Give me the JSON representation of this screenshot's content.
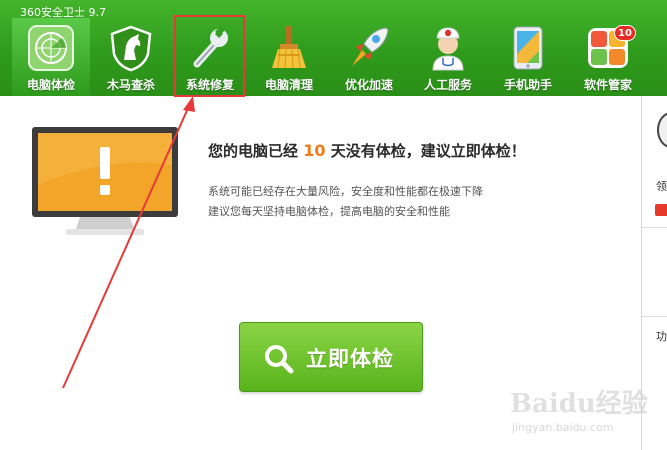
{
  "app": {
    "title": "360安全卫士 9.7"
  },
  "toolbar": {
    "items": [
      {
        "label": "电脑体检",
        "icon": "radar-icon"
      },
      {
        "label": "木马查杀",
        "icon": "horse-shield-icon"
      },
      {
        "label": "系统修复",
        "icon": "wrench-icon"
      },
      {
        "label": "电脑清理",
        "icon": "broom-icon"
      },
      {
        "label": "优化加速",
        "icon": "rocket-icon"
      },
      {
        "label": "人工服务",
        "icon": "doctor-icon"
      },
      {
        "label": "手机助手",
        "icon": "phone-icon"
      },
      {
        "label": "软件管家",
        "icon": "apps-grid-icon"
      }
    ],
    "badge_count": "10"
  },
  "main": {
    "headline_pre": "您的电脑已经",
    "headline_days": "10",
    "headline_post": "天没有体检，建议立即体检！",
    "desc_line1": "系统可能已经存在大量风险，安全度和性能都在极速下降",
    "desc_line2": "建议您每天坚持电脑体检，提高电脑的安全和性能",
    "cta_label": "立即体检"
  },
  "right_panel": {
    "text1": "领",
    "text2": "功"
  },
  "watermark": {
    "brand": "Baidu经验",
    "sub": "jingyan.baidu.com"
  },
  "colors": {
    "toolbar_green": "#2f9b1c",
    "cta_green": "#6cc22c",
    "accent_orange": "#f07a16",
    "annotation_red": "#e63a3a"
  }
}
